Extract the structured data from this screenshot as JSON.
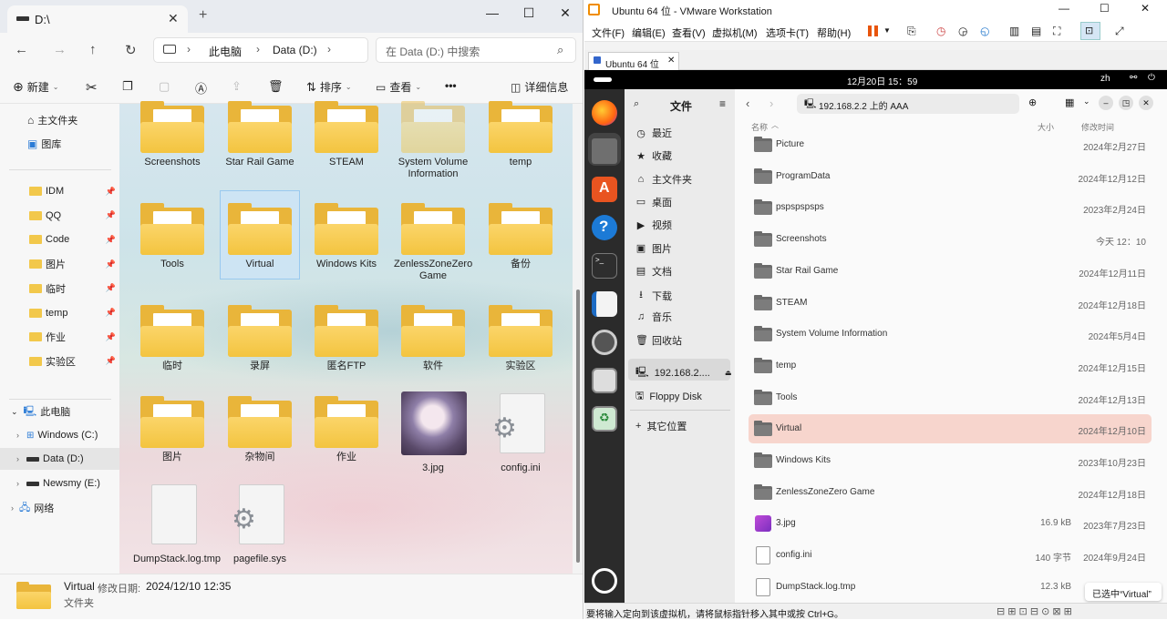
{
  "explorer": {
    "tab_title": "D:\\",
    "tab_close": "✕",
    "new_tab": "+",
    "window": {
      "minimize": "—",
      "maximize": "☐",
      "close": "✕"
    },
    "breadcrumb": [
      "此电脑",
      "Data (D:)"
    ],
    "search_placeholder": "在 Data (D:) 中搜索",
    "commands": {
      "new": "新建",
      "sort": "排序",
      "view": "查看",
      "more": "•••",
      "details": "详细信息"
    },
    "nav": {
      "home": "主文件夹",
      "gallery": "图库",
      "pinned": [
        "IDM",
        "QQ",
        "Code",
        "图片",
        "临时",
        "temp",
        "作业",
        "实验区"
      ],
      "this_pc": "此电脑",
      "drives": [
        "Windows (C:)",
        "Data (D:)",
        "Newsmy (E:)"
      ],
      "network": "网络"
    },
    "items": [
      {
        "name": "Screenshots",
        "kind": "folder"
      },
      {
        "name": "Star Rail Game",
        "kind": "folder"
      },
      {
        "name": "STEAM",
        "kind": "folder"
      },
      {
        "name": "System Volume Information",
        "kind": "folder-faded"
      },
      {
        "name": "temp",
        "kind": "folder"
      },
      {
        "name": "Tools",
        "kind": "folder"
      },
      {
        "name": "Virtual",
        "kind": "folder",
        "selected": true
      },
      {
        "name": "Windows Kits",
        "kind": "folder"
      },
      {
        "name": "ZenlessZoneZero Game",
        "kind": "folder"
      },
      {
        "name": "备份",
        "kind": "folder"
      },
      {
        "name": "临时",
        "kind": "folder"
      },
      {
        "name": "录屏",
        "kind": "folder"
      },
      {
        "name": "匿名FTP",
        "kind": "folder"
      },
      {
        "name": "软件",
        "kind": "folder"
      },
      {
        "name": "实验区",
        "kind": "folder"
      },
      {
        "name": "图片",
        "kind": "folder"
      },
      {
        "name": "杂物间",
        "kind": "folder"
      },
      {
        "name": "作业",
        "kind": "folder"
      },
      {
        "name": "3.jpg",
        "kind": "image"
      },
      {
        "name": "config.ini",
        "kind": "config"
      },
      {
        "name": "DumpStack.log.tmp",
        "kind": "doc"
      },
      {
        "name": "pagefile.sys",
        "kind": "config"
      }
    ],
    "status": {
      "name": "Virtual",
      "modified_label": "修改日期:",
      "modified": "2024/12/10 12:35",
      "type": "文件夹"
    }
  },
  "vmware": {
    "title": "Ubuntu 64 位 - VMware Workstation",
    "menu": [
      "文件(F)",
      "编辑(E)",
      "查看(V)",
      "虚拟机(M)",
      "选项卡(T)",
      "帮助(H)"
    ],
    "tab": "Ubuntu 64 位",
    "status_text": "要将输入定向到该虚拟机，请将鼠标指针移入其中或按 Ctrl+G。",
    "guest": {
      "clock": "12月20日 15：59",
      "lang": "zh",
      "sidebar_title": "文件",
      "location": "192.168.2.2 上的 AAA",
      "places": [
        "最近",
        "收藏",
        "主文件夹",
        "桌面",
        "视频",
        "图片",
        "文档",
        "下载",
        "音乐",
        "回收站"
      ],
      "network_mount": "192.168.2....",
      "floppy": "Floppy Disk",
      "other": "其它位置",
      "columns": {
        "name": "名称",
        "size": "大小",
        "modified": "修改时间"
      },
      "files": [
        {
          "name": "Picture",
          "size": "",
          "date": "2024年2月27日",
          "kind": "folder"
        },
        {
          "name": "ProgramData",
          "size": "",
          "date": "2024年12月12日",
          "kind": "folder"
        },
        {
          "name": "pspspspsps",
          "size": "",
          "date": "2023年2月24日",
          "kind": "folder"
        },
        {
          "name": "Screenshots",
          "size": "",
          "date": "今天 12：10",
          "kind": "folder"
        },
        {
          "name": "Star Rail Game",
          "size": "",
          "date": "2024年12月11日",
          "kind": "folder"
        },
        {
          "name": "STEAM",
          "size": "",
          "date": "2024年12月18日",
          "kind": "folder"
        },
        {
          "name": "System Volume Information",
          "size": "",
          "date": "2024年5月4日",
          "kind": "folder"
        },
        {
          "name": "temp",
          "size": "",
          "date": "2024年12月15日",
          "kind": "folder"
        },
        {
          "name": "Tools",
          "size": "",
          "date": "2024年12月13日",
          "kind": "folder"
        },
        {
          "name": "Virtual",
          "size": "",
          "date": "2024年12月10日",
          "kind": "folder",
          "selected": true
        },
        {
          "name": "Windows Kits",
          "size": "",
          "date": "2023年10月23日",
          "kind": "folder"
        },
        {
          "name": "ZenlessZoneZero Game",
          "size": "",
          "date": "2024年12月18日",
          "kind": "folder"
        },
        {
          "name": "3.jpg",
          "size": "16.9 kB",
          "date": "2023年7月23日",
          "kind": "image"
        },
        {
          "name": "config.ini",
          "size": "140 字节",
          "date": "2024年9月24日",
          "kind": "text"
        },
        {
          "name": "DumpStack.log.tmp",
          "size": "12.3 kB",
          "date": "",
          "kind": "text"
        }
      ],
      "selection_toast": "已选中“Virtual”"
    }
  }
}
